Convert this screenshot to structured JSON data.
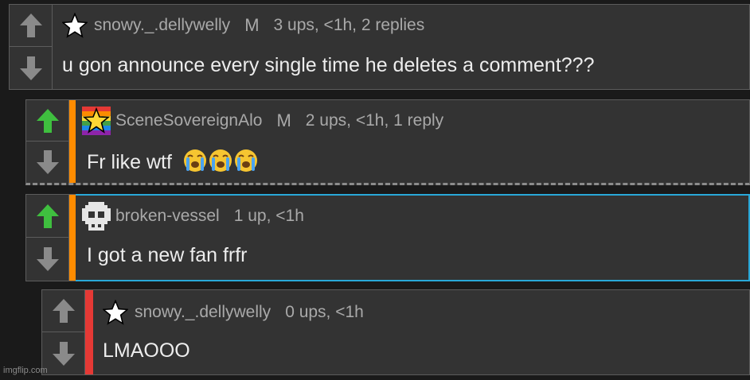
{
  "colors": {
    "up_active": "#3fbf3f",
    "up_inactive": "#8a8a8a",
    "down": "#8a8a8a",
    "stripe_orange": "#ff8c00",
    "stripe_red": "#e53935",
    "highlight_border": "#29a8d8",
    "dashed_border": "#8c8c8c"
  },
  "comments": [
    {
      "username": "snowy._.dellywelly",
      "badge": "M",
      "meta": "3 ups, <1h, 2 replies",
      "body": "u gon announce every single time he deletes a comment???",
      "avatar_icon": "star-icon",
      "upvoted": false
    },
    {
      "username": "SceneSovereignAlo",
      "badge": "M",
      "meta": "2 ups, <1h, 1 reply",
      "body": "Fr like wtf",
      "body_emojis": "😭😭😭",
      "avatar_icon": "rainbow-star-icon",
      "upvoted": true
    },
    {
      "username": "broken-vessel",
      "badge": "",
      "meta": "1 up, <1h",
      "body": "I got a new fan frfr",
      "avatar_icon": "pixel-skull-icon",
      "upvoted": true
    },
    {
      "username": "snowy._.dellywelly",
      "badge": "",
      "meta": "0 ups, <1h",
      "body": "LMAOOO",
      "avatar_icon": "star-icon",
      "upvoted": false
    }
  ],
  "watermark": "imgflip.com"
}
